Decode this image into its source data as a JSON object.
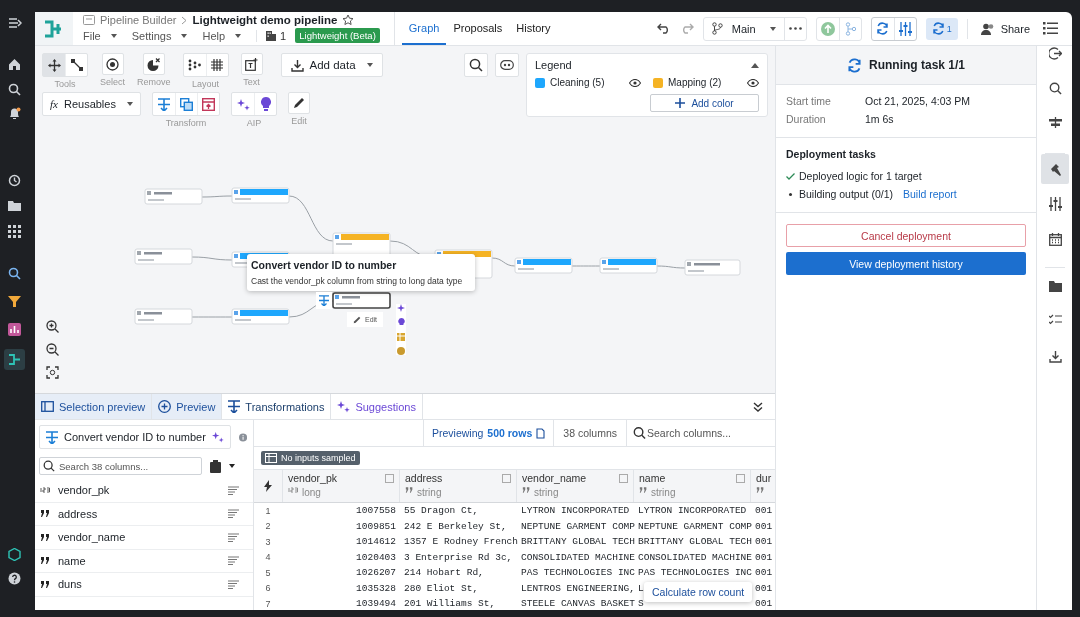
{
  "header": {
    "breadcrumb": "Pipeline Builder",
    "title": "Lightweight demo pipeline",
    "menus": [
      "File",
      "Settings",
      "Help"
    ],
    "projects_count": "1",
    "badge": "Lightweight (Beta)"
  },
  "tabs": [
    {
      "label": "Graph",
      "selected": true
    },
    {
      "label": "Proposals",
      "selected": false
    },
    {
      "label": "History",
      "selected": false
    }
  ],
  "branch": "Main",
  "builds_count": "1",
  "share": "Share",
  "toolbar": {
    "tools": [
      {
        "kind": "pan",
        "selected": true
      },
      {
        "kind": "connect",
        "selected": false
      }
    ],
    "labels": [
      "Tools",
      "Select",
      "Remove",
      "Layout",
      "Text"
    ],
    "add_data": "Add data",
    "reusables_symbol": "fx",
    "reusables": "Reusables",
    "labels2": [
      "Transform",
      "AIP",
      "Edit"
    ]
  },
  "legend": {
    "title": "Legend",
    "items": [
      {
        "label": "Cleaning (5)",
        "color": "#1ea7fd"
      },
      {
        "label": "Mapping (2)",
        "color": "#f5b324"
      }
    ],
    "add": "Add color"
  },
  "graph": {
    "nodes": [
      {
        "kind": "dataset",
        "selected": false
      },
      {
        "kind": "transform",
        "color": "#1ea7fd",
        "selected": false
      },
      {
        "kind": "transform",
        "color": "#f5b324",
        "selected": false
      },
      {
        "kind": "dataset",
        "selected": false
      },
      {
        "kind": "transform",
        "color": "#1ea7fd",
        "selected": false
      },
      {
        "kind": "transform",
        "color": "#f5b324",
        "selected": false
      },
      {
        "kind": "transform",
        "color": "#1ea7fd",
        "selected": false
      },
      {
        "kind": "transform",
        "color": "#1ea7fd",
        "selected": false
      },
      {
        "kind": "output",
        "selected": false
      },
      {
        "kind": "dataset",
        "selected": false
      },
      {
        "kind": "transform",
        "color": "#1ea7fd",
        "selected": false
      },
      {
        "kind": "transform",
        "selected": true
      }
    ]
  },
  "tooltip": {
    "title": "Convert vendor ID to number",
    "text": "Cast the vendor_pk column from string to long data type"
  },
  "node_edit": "Edit",
  "bottom_tabs": [
    {
      "label": "Selection preview",
      "kind": "mode",
      "selected": false
    },
    {
      "label": "Preview",
      "kind": "mode",
      "selected": false
    },
    {
      "label": "Transformations",
      "kind": "panel",
      "selected": true
    },
    {
      "label": "Suggestions",
      "kind": "ai",
      "selected": false
    }
  ],
  "transform": {
    "name": "Convert vendor ID to number",
    "search_placeholder": "Search 38 columns..."
  },
  "columns_list": [
    {
      "name": "vendor_pk",
      "kind": "number"
    },
    {
      "name": "address",
      "kind": "string"
    },
    {
      "name": "vendor_name",
      "kind": "string"
    },
    {
      "name": "name",
      "kind": "string"
    },
    {
      "name": "duns",
      "kind": "string"
    }
  ],
  "preview": {
    "label": "Previewing",
    "rows": "500 rows",
    "columns": "38 columns",
    "search_placeholder": "Search columns...",
    "badge": "No inputs sampled"
  },
  "table": {
    "columns": [
      {
        "name": "vendor_pk",
        "type": "long",
        "kind": "number"
      },
      {
        "name": "address",
        "type": "string",
        "kind": "string"
      },
      {
        "name": "vendor_name",
        "type": "string",
        "kind": "string"
      },
      {
        "name": "name",
        "type": "string",
        "kind": "string"
      },
      {
        "name": "dur",
        "kind": "string"
      }
    ],
    "rows": [
      {
        "index": "1",
        "cells": [
          "1007558",
          "55 Dragon Ct,",
          "LYTRON INCORPORATED",
          "LYTRON INCORPORATED",
          "001"
        ]
      },
      {
        "index": "2",
        "cells": [
          "1009851",
          "242 E Berkeley St,",
          "NEPTUNE GARMENT COMP",
          "NEPTUNE GARMENT COMP",
          "001"
        ]
      },
      {
        "index": "3",
        "cells": [
          "1014612",
          "1357 E Rodney French",
          "BRITTANY GLOBAL TECH",
          "BRITTANY GLOBAL TECH",
          "001"
        ]
      },
      {
        "index": "4",
        "cells": [
          "1020403",
          "3 Enterprise Rd 3c,",
          "CONSOLIDATED MACHINE",
          "CONSOLIDATED MACHINE",
          "001"
        ]
      },
      {
        "index": "5",
        "cells": [
          "1026207",
          "214 Hobart Rd,",
          "PAS TECHNOLOGIES INC",
          "PAS TECHNOLOGIES INC",
          "001"
        ]
      },
      {
        "index": "6",
        "cells": [
          "1035328",
          "280 Eliot St,",
          "LENTROS ENGINEERING,",
          "L",
          "001"
        ]
      },
      {
        "index": "7",
        "cells": [
          "1039494",
          "201 Williams St,",
          "STEELE CANVAS BASKET",
          "S",
          "001"
        ]
      }
    ]
  },
  "popup": "Calculate row count",
  "run": {
    "title": "Running task 1/1",
    "details": [
      {
        "label": "Start time",
        "value": "Oct 21, 2025, 4:03 PM"
      },
      {
        "label": "Duration",
        "value": "1m 6s"
      }
    ],
    "tasks_title": "Deployment tasks",
    "tasks": [
      {
        "text": "Deployed logic for 1 target",
        "done": true
      },
      {
        "text": "Building output (0/1)",
        "done": false,
        "link": "Build report"
      }
    ],
    "cancel": "Cancel deployment",
    "history": "View deployment history"
  },
  "right_bar": [
    {
      "kind": "exit",
      "selected": false
    },
    {
      "kind": "search",
      "selected": false
    },
    {
      "kind": "align",
      "selected": false
    },
    {
      "kind": "hammer",
      "selected": true
    },
    {
      "kind": "sliders",
      "selected": false
    },
    {
      "kind": "calendar",
      "selected": false
    },
    {
      "kind": "folder",
      "selected": false
    },
    {
      "kind": "checklist",
      "selected": false
    },
    {
      "kind": "download",
      "selected": false
    }
  ]
}
